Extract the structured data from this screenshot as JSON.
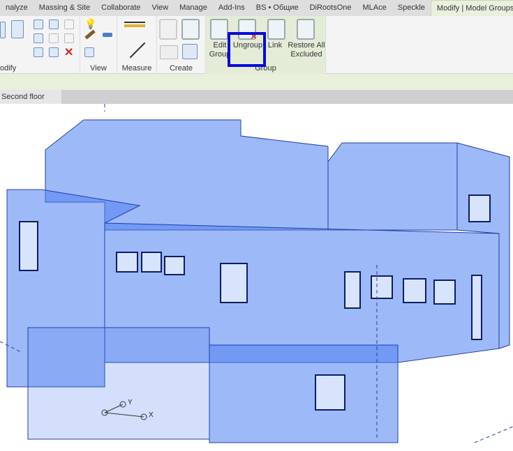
{
  "tabs": [
    "nalyze",
    "Massing & Site",
    "Collaborate",
    "View",
    "Manage",
    "Add-Ins",
    "BS • Общие",
    "DiRootsOne",
    "MLAce",
    "Speckle",
    "Modify | Model Groups"
  ],
  "panels": {
    "modify": "odify",
    "view": "View",
    "measure": "Measure",
    "create": "Create",
    "group": "Group"
  },
  "group_buttons": {
    "edit": [
      "Edit",
      "Group"
    ],
    "ungroup": "Ungroup",
    "link": "Link",
    "restore": [
      "Restore All",
      "Excluded"
    ]
  },
  "view_tab": "Second floor",
  "axes": {
    "y": "Y",
    "x": "X"
  },
  "colors": {
    "highlight": "#0a0adc",
    "building": "#4f7ff0",
    "active_tab": "#e9f1dd"
  }
}
